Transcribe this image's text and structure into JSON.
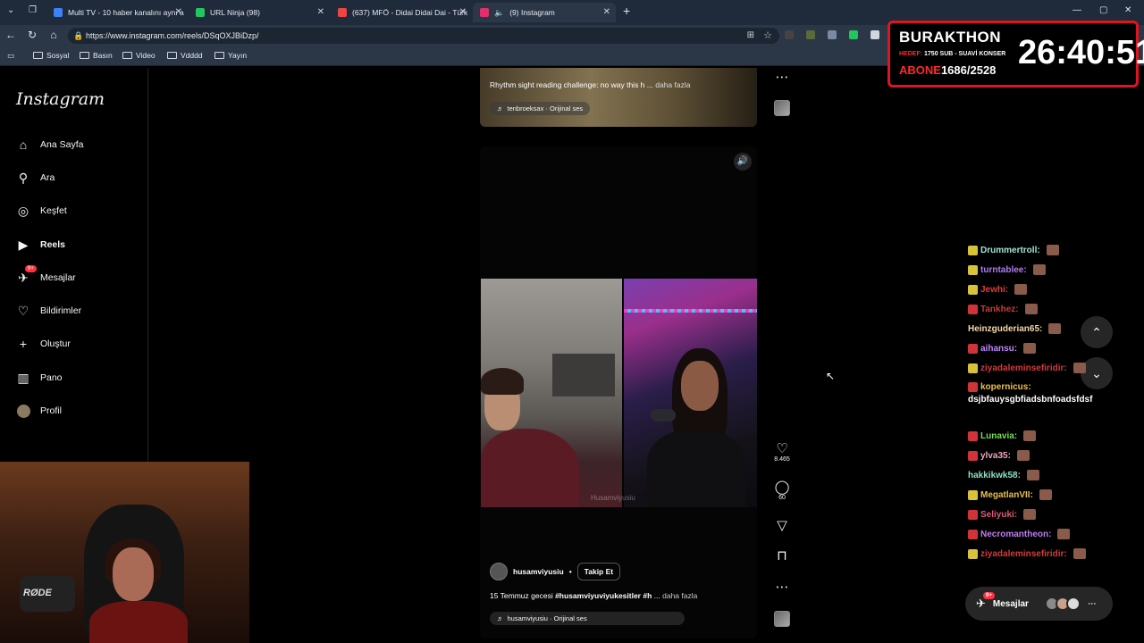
{
  "browser": {
    "tabs": [
      {
        "title": "Multi TV - 10 haber kanalını aynı a",
        "fav_color": "#3b82f6"
      },
      {
        "title": "URL Ninja (98)",
        "fav_color": "#22c55e"
      },
      {
        "title": "(637) MFÖ - Didai Didai Dai - Türk",
        "fav_color": "#ef4444"
      },
      {
        "title": "(9) Instagram",
        "fav_color": "#e1306c"
      }
    ],
    "new_tab": "+",
    "url": "https://www.instagram.com/reels/DSqOXJBiDzp/",
    "bookmarks": [
      "Sosyal",
      "Basın",
      "Video",
      "Vdddd",
      "Yayın"
    ]
  },
  "instagram": {
    "logo": "Instagram",
    "nav": [
      {
        "label": "Ana Sayfa",
        "icon": "home-icon"
      },
      {
        "label": "Ara",
        "icon": "search-icon"
      },
      {
        "label": "Keşfet",
        "icon": "compass-icon"
      },
      {
        "label": "Reels",
        "icon": "reels-icon"
      },
      {
        "label": "Mesajlar",
        "icon": "messenger-icon",
        "badge": "9+"
      },
      {
        "label": "Bildirimler",
        "icon": "heart-icon"
      },
      {
        "label": "Oluştur",
        "icon": "plus-icon"
      },
      {
        "label": "Pano",
        "icon": "dashboard-icon"
      },
      {
        "label": "Profil",
        "icon": "profile-avatar"
      }
    ],
    "reel_prev": {
      "caption": "Rhythm sight reading challenge: no way this h ...",
      "more": "daha fazla",
      "audio": "tenbroeksax · Orijinal ses"
    },
    "reel": {
      "watermark": "Husamviyusiu",
      "username": "husamviyusiu",
      "follow": "Takip Et",
      "caption_text": "15 Temmuz gecesi ",
      "caption_tag": "#husamviyuviyukesitler #h",
      "caption_ellipsis": " ...",
      "more": "daha fazla",
      "audio": "husamviyusiu · Orijinal ses",
      "likes": "8.465",
      "comments": "60"
    },
    "messages_pill": {
      "label": "Mesajlar",
      "badge": "9+"
    }
  },
  "stream_overlay": {
    "channel": "BURAKTHON",
    "goal_label": "HEDEF:",
    "goal_text": "1750 SUB - SUAVİ KONSER",
    "sub_label": "ABONE",
    "sub_count": "1686/2528",
    "timer": "26:40:51"
  },
  "chat": [
    {
      "user": "Drummertroll:",
      "msg": "",
      "color": "#9be6d4",
      "badge": "#d8c23a"
    },
    {
      "user": "turntablee:",
      "msg": "",
      "color": "#b07cf0",
      "badge": "#d8c23a"
    },
    {
      "user": "Jewhi:",
      "msg": "",
      "color": "#e03b3b",
      "badge": "#d8c23a"
    },
    {
      "user": "Tankhez:",
      "msg": "",
      "color": "#c83a3a",
      "badge": "#d0343a"
    },
    {
      "user": "Heinzguderian65:",
      "msg": "",
      "color": "#f0d9a8",
      "badge": ""
    },
    {
      "user": "aihansu:",
      "msg": "",
      "color": "#c084fc",
      "badge": "#d0343a"
    },
    {
      "user": "ziyadaleminsefiridir:",
      "msg": "",
      "color": "#d23b3b",
      "badge": "#d8c23a"
    },
    {
      "user": "kopernicus:",
      "msg": "dsjbfauysgbfiadsbnfoadsfdsf",
      "color": "#e8c14a",
      "badge": "#d0343a"
    },
    {
      "user": "Lunavia:",
      "msg": "",
      "color": "#7bdc57",
      "badge": "#d0343a"
    },
    {
      "user": "ylva35:",
      "msg": "",
      "color": "#f0a3c0",
      "badge": "#d0343a"
    },
    {
      "user": "hakkikwk58:",
      "msg": "",
      "color": "#8be0c0",
      "badge": ""
    },
    {
      "user": "MegatlanVII:",
      "msg": "",
      "color": "#e8c14a",
      "badge": "#d8c23a"
    },
    {
      "user": "Seliyuki:",
      "msg": "",
      "color": "#e05a7a",
      "badge": "#d0343a"
    },
    {
      "user": "Necromantheon:",
      "msg": "",
      "color": "#c07cf0",
      "badge": "#d0343a"
    },
    {
      "user": "ziyadaleminsefiridir:",
      "msg": "",
      "color": "#d23b3b",
      "badge": "#d8c23a"
    }
  ],
  "webcam": {
    "mic_brand": "RØDE"
  },
  "colors": {
    "accent_red": "#e0141e",
    "ig_badge": "#ff3040",
    "chrome_bg": "#1f2a3a"
  }
}
